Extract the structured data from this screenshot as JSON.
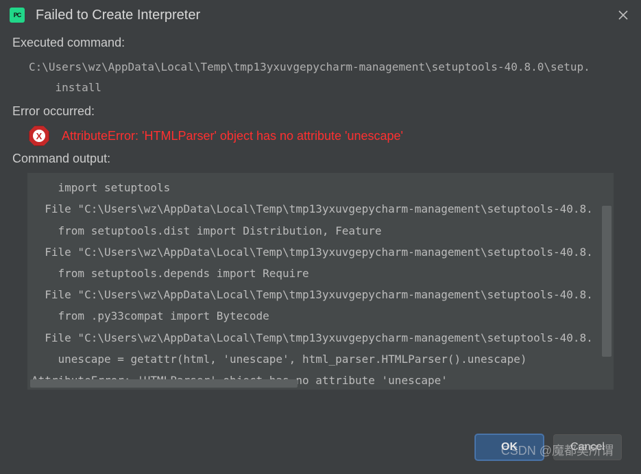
{
  "dialog": {
    "title": "Failed to Create Interpreter"
  },
  "sections": {
    "executed_label": "Executed command:",
    "error_label": "Error occurred:",
    "output_label": "Command output:"
  },
  "executed_command": "C:\\Users\\wz\\AppData\\Local\\Temp\\tmp13yxuvgepycharm-management\\setuptools-40.8.0\\setup.\n    install",
  "error_message": "AttributeError: 'HTMLParser' object has no attribute 'unescape'",
  "command_output": "    import setuptools\n  File \"C:\\Users\\wz\\AppData\\Local\\Temp\\tmp13yxuvgepycharm-management\\setuptools-40.8.\n    from setuptools.dist import Distribution, Feature\n  File \"C:\\Users\\wz\\AppData\\Local\\Temp\\tmp13yxuvgepycharm-management\\setuptools-40.8.\n    from setuptools.depends import Require\n  File \"C:\\Users\\wz\\AppData\\Local\\Temp\\tmp13yxuvgepycharm-management\\setuptools-40.8.\n    from .py33compat import Bytecode\n  File \"C:\\Users\\wz\\AppData\\Local\\Temp\\tmp13yxuvgepycharm-management\\setuptools-40.8.\n    unescape = getattr(html, 'unescape', html_parser.HTMLParser().unescape)\nAttributeError: 'HTMLParser' object has no attribute 'unescape'",
  "buttons": {
    "ok": "OK",
    "cancel": "Cancel"
  },
  "watermark": "CSDN @魔都吴所谓"
}
